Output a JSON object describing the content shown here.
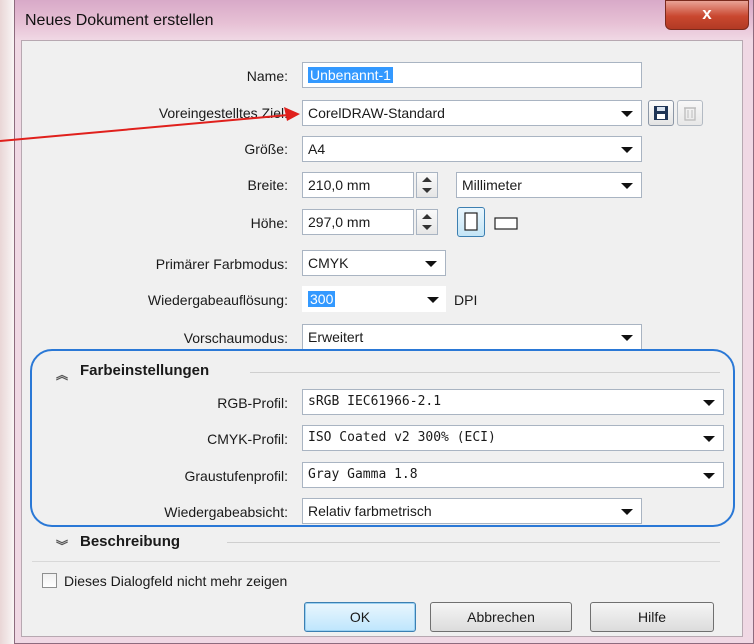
{
  "window": {
    "title": "Neues Dokument erstellen",
    "close_label": "x"
  },
  "fields": {
    "name_label": "Name:",
    "name_value": "Unbenannt-1",
    "preset_label": "Voreingestelltes Ziel:",
    "preset_value": "CorelDRAW-Standard",
    "size_label": "Größe:",
    "size_value": "A4",
    "width_label": "Breite:",
    "width_value": "210,0 mm",
    "unit_value": "Millimeter",
    "height_label": "Höhe:",
    "height_value": "297,0 mm",
    "colormode_label": "Primärer Farbmodus:",
    "colormode_value": "CMYK",
    "resolution_label": "Wiedergabeauflösung:",
    "resolution_value": "300",
    "resolution_unit": "DPI",
    "preview_label": "Vorschaumodus:",
    "preview_value": "Erweitert"
  },
  "color_settings": {
    "header": "Farbeinstellungen",
    "rgb_label": "RGB-Profil:",
    "rgb_value": "sRGB IEC61966-2.1",
    "cmyk_label": "CMYK-Profil:",
    "cmyk_value": "ISO Coated v2 300% (ECI)",
    "gray_label": "Graustufenprofil:",
    "gray_value": "Gray Gamma 1.8",
    "intent_label": "Wiedergabeabsicht:",
    "intent_value": "Relativ farbmetrisch"
  },
  "description": {
    "header": "Beschreibung"
  },
  "footer": {
    "dont_show_label": "Dieses Dialogfeld nicht mehr zeigen",
    "ok_label": "OK",
    "cancel_label": "Abbrechen",
    "help_label": "Hilfe"
  },
  "annotation_colors": {
    "arrow": "#e0201c",
    "ellipse": "#2a78d6"
  }
}
